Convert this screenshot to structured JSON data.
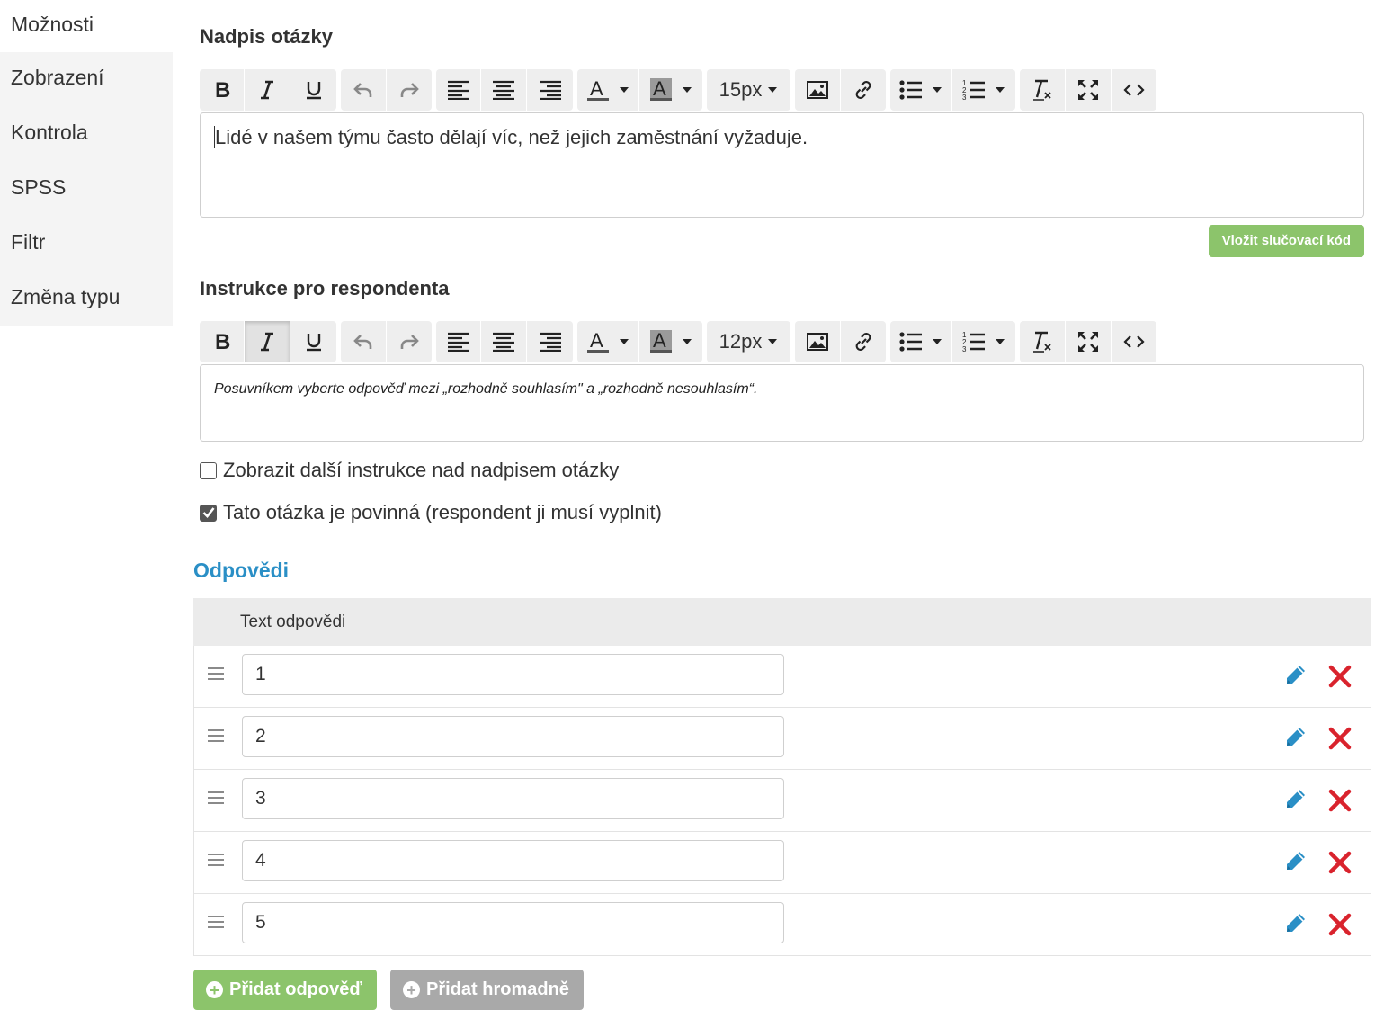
{
  "sidebar": {
    "items": [
      {
        "label": "Možnosti"
      },
      {
        "label": "Zobrazení"
      },
      {
        "label": "Kontrola"
      },
      {
        "label": "SPSS"
      },
      {
        "label": "Filtr"
      },
      {
        "label": "Změna typu"
      }
    ],
    "active_index": 0
  },
  "question_title": {
    "label": "Nadpis otázky",
    "font_size": "15px",
    "text": "Lidé v našem týmu často dělají víc, než jejich zaměstnání vyžaduje."
  },
  "merge_button_label": "Vložit slučovací kód",
  "instructions": {
    "label": "Instrukce pro respondenta",
    "font_size": "12px",
    "text": "Posuvníkem vyberte odpověď mezi „rozhodně souhlasím\" a „rozhodně nesouhlasím“."
  },
  "options": {
    "show_instructions_above": {
      "label": "Zobrazit další instrukce nad nadpisem otázky",
      "checked": false
    },
    "required": {
      "label": "Tato otázka je povinná (respondent ji musí vyplnit)",
      "checked": true
    }
  },
  "answers": {
    "title": "Odpovědi",
    "column_header": "Text odpovědi",
    "rows": [
      {
        "text": "1"
      },
      {
        "text": "2"
      },
      {
        "text": "3"
      },
      {
        "text": "4"
      },
      {
        "text": "5"
      }
    ]
  },
  "buttons": {
    "add_answer": "Přidat odpověď",
    "add_bulk": "Přidat hromadně"
  },
  "toolbar_icons": [
    "bold-icon",
    "italic-icon",
    "underline-icon",
    "undo-icon",
    "redo-icon",
    "align-left-icon",
    "align-center-icon",
    "align-right-icon",
    "text-color-icon",
    "highlight-color-icon",
    "font-size-select",
    "image-icon",
    "link-icon",
    "bullet-list-icon",
    "numbered-list-icon",
    "clear-format-icon",
    "fullscreen-icon",
    "code-view-icon"
  ],
  "colors": {
    "accent_blue": "#2a8fc6",
    "green_button": "#8cc46b",
    "grey_button": "#a9a9a9",
    "delete_red": "#d9232d",
    "edit_blue": "#2a8fc6"
  }
}
